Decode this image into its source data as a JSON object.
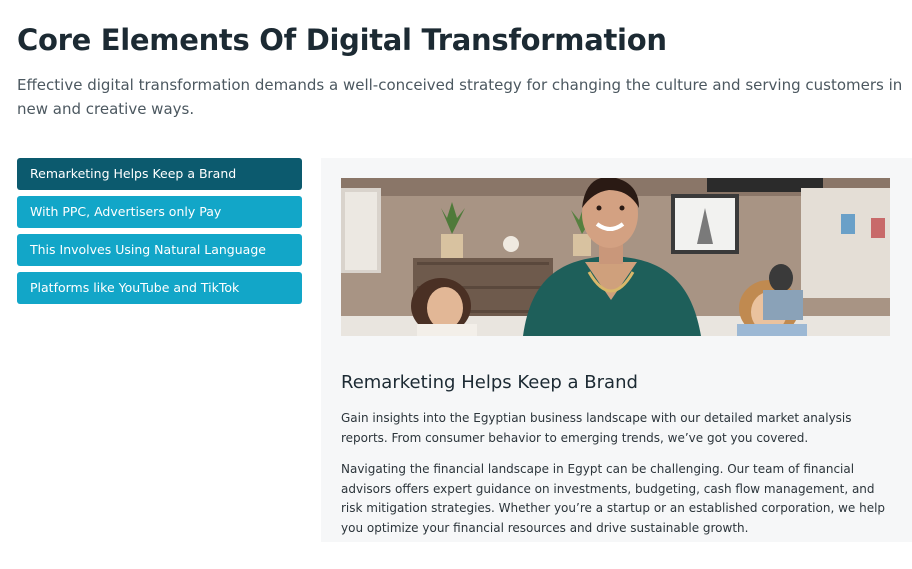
{
  "section": {
    "title": "Core Elements Of Digital Transformation",
    "intro": "Effective digital transformation demands a well-conceived strategy for changing the culture and serving customers in new and creative ways."
  },
  "tabs": [
    {
      "label": "Remarketing Helps Keep a Brand",
      "active": true
    },
    {
      "label": "With PPC, Advertisers only Pay",
      "active": false
    },
    {
      "label": "This Involves Using Natural Language",
      "active": false
    },
    {
      "label": "Platforms like YouTube and TikTok",
      "active": false
    }
  ],
  "panel": {
    "heading": "Remarketing Helps Keep a Brand",
    "paragraphs": [
      "Gain insights into the Egyptian business landscape with our detailed market analysis reports. From consumer behavior to emerging trends, we’ve got you covered.",
      "Navigating the financial landscape in Egypt can be challenging. Our team of financial advisors offers expert guidance on investments, budgeting, cash flow management, and risk mitigation strategies. Whether you’re a startup or an established corporation, we help you optimize your financial resources and drive sustainable growth."
    ]
  },
  "colors": {
    "tab_active": "#0c5a6e",
    "tab_inactive": "#12a6c8",
    "panel_background": "#f6f7f8",
    "title_text": "#1c2a33"
  }
}
